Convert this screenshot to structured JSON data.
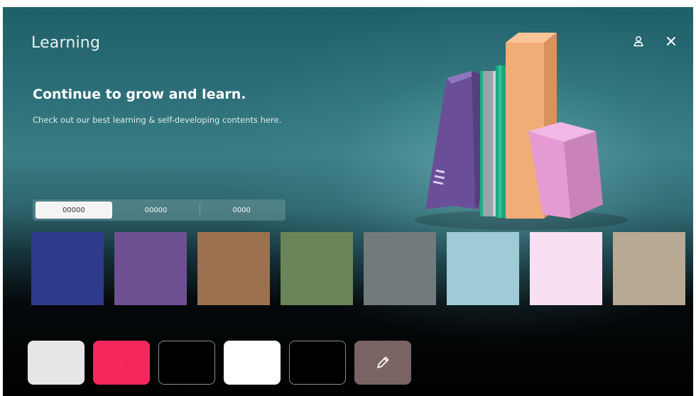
{
  "header": {
    "title": "Learning"
  },
  "hero": {
    "headline": "Continue to grow and learn.",
    "description": "Check out our best learning & self-developing contents here."
  },
  "top_icons": [
    "user-icon",
    "close-icon"
  ],
  "tabs": [
    {
      "label": "00000",
      "active": true
    },
    {
      "label": "00000",
      "active": false
    },
    {
      "label": "0000",
      "active": false
    }
  ],
  "swatches": [
    {
      "color": "#2e3a8a"
    },
    {
      "color": "#6f5193"
    },
    {
      "color": "#9c7150"
    },
    {
      "color": "#6a8559"
    },
    {
      "color": "#727b7b"
    },
    {
      "color": "#9fcbd6"
    },
    {
      "color": "#f8e0f2"
    },
    {
      "color": "#b8a994"
    }
  ],
  "tools": [
    {
      "name": "light-gray-button",
      "background": "#e6e6e6",
      "border": "none",
      "label": ""
    },
    {
      "name": "pink-button",
      "background": "#f5285e",
      "border": "none",
      "label": "-"
    },
    {
      "name": "black-button",
      "background": "#000000",
      "border": "#8a8a8a",
      "label": ""
    },
    {
      "name": "white-button",
      "background": "#ffffff",
      "border": "none",
      "label": ""
    },
    {
      "name": "black-outline-button",
      "background": "#000000",
      "border": "#8a8a8a",
      "label": ""
    },
    {
      "name": "edit-button",
      "background": "#7a6363",
      "border": "none",
      "icon": "pencil-icon"
    }
  ],
  "book_colors": {
    "purple": "#7b5fa8",
    "gray": "#a9b0b4",
    "green": "#1fae84",
    "orange": "#f0b07a",
    "pink": "#e6a3d9"
  }
}
